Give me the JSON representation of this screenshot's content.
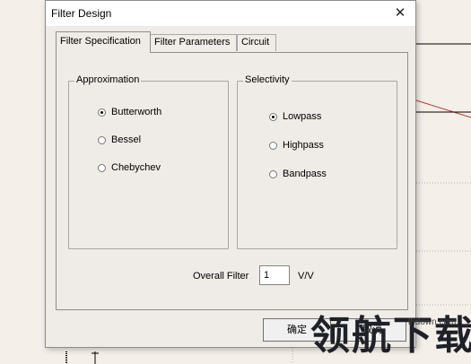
{
  "dialog": {
    "title": "Filter Design",
    "close_glyph": "✕"
  },
  "tabs": [
    {
      "label": "Filter Specification",
      "active": true
    },
    {
      "label": "Filter Parameters",
      "active": false
    },
    {
      "label": "Circuit",
      "active": false
    }
  ],
  "approximation": {
    "label": "Approximation",
    "options": [
      {
        "label": "Butterworth",
        "selected": true
      },
      {
        "label": "Bessel",
        "selected": false
      },
      {
        "label": "Chebychev",
        "selected": false
      }
    ]
  },
  "selectivity": {
    "label": "Selectivity",
    "options": [
      {
        "label": "Lowpass",
        "selected": true
      },
      {
        "label": "Highpass",
        "selected": false
      },
      {
        "label": "Bandpass",
        "selected": false
      }
    ]
  },
  "overall_filter": {
    "label": "Overall Filter",
    "value": "1",
    "unit": "V/V"
  },
  "buttons": {
    "ok": "确定",
    "cancel": "取消"
  },
  "watermark": {
    "text": "领航下载",
    "url": "lhdown.com"
  },
  "colors": {
    "annotation_arrow": "#d42a2a",
    "background_curve": "#c0392b"
  }
}
